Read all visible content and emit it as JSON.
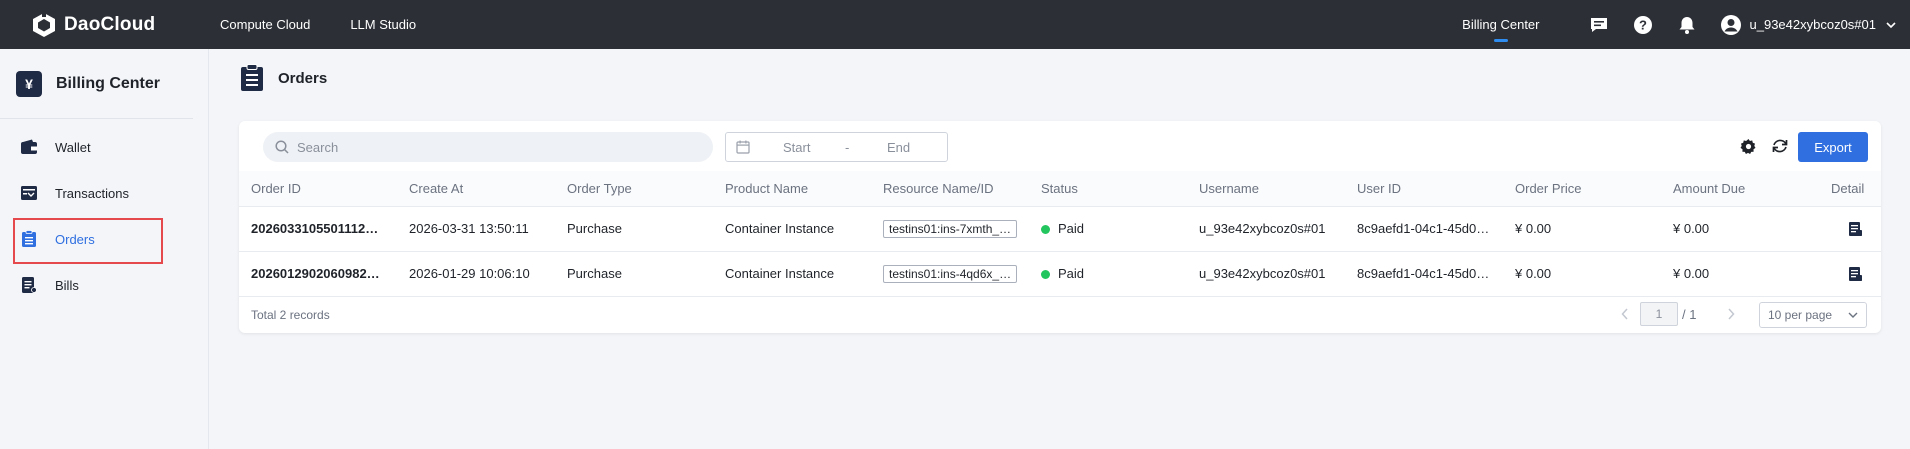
{
  "topbar": {
    "brand": "DaoCloud",
    "nav": [
      "Compute Cloud",
      "LLM Studio"
    ],
    "active_tab": "Billing Center",
    "username": "u_93e42xybcoz0s#01"
  },
  "sidebar": {
    "title": "Billing Center",
    "items": [
      {
        "label": "Wallet"
      },
      {
        "label": "Transactions"
      },
      {
        "label": "Orders"
      },
      {
        "label": "Bills"
      }
    ]
  },
  "page": {
    "title": "Orders"
  },
  "toolbar": {
    "search_placeholder": "Search",
    "date_start": "Start",
    "date_sep": "-",
    "date_end": "End",
    "export_label": "Export"
  },
  "table": {
    "columns": [
      "Order ID",
      "Create At",
      "Order Type",
      "Product Name",
      "Resource Name/ID",
      "Status",
      "Username",
      "User ID",
      "Order Price",
      "Amount Due",
      "Detail"
    ],
    "rows": [
      {
        "order_id": "2026033105501112…",
        "create_at": "2026-03-31 13:50:11",
        "order_type": "Purchase",
        "product": "Container Instance",
        "resource": "testins01:ins-7xmth_…",
        "status": "Paid",
        "username": "u_93e42xybcoz0s#01",
        "user_id": "8c9aefd1-04c1-45d0…",
        "price": "¥ 0.00",
        "due": "¥ 0.00"
      },
      {
        "order_id": "2026012902060982…",
        "create_at": "2026-01-29 10:06:10",
        "order_type": "Purchase",
        "product": "Container Instance",
        "resource": "testins01:ins-4qd6x_…",
        "status": "Paid",
        "username": "u_93e42xybcoz0s#01",
        "user_id": "8c9aefd1-04c1-45d0…",
        "price": "¥ 0.00",
        "due": "¥ 0.00"
      }
    ]
  },
  "footer": {
    "total": "Total 2 records",
    "page_current": "1",
    "page_total": "/ 1",
    "per_page": "10 per page"
  },
  "colors": {
    "topbar": "#2c2f36",
    "accent": "#2f6fe0",
    "paid": "#22c55e",
    "highlight": "#e5484d"
  }
}
